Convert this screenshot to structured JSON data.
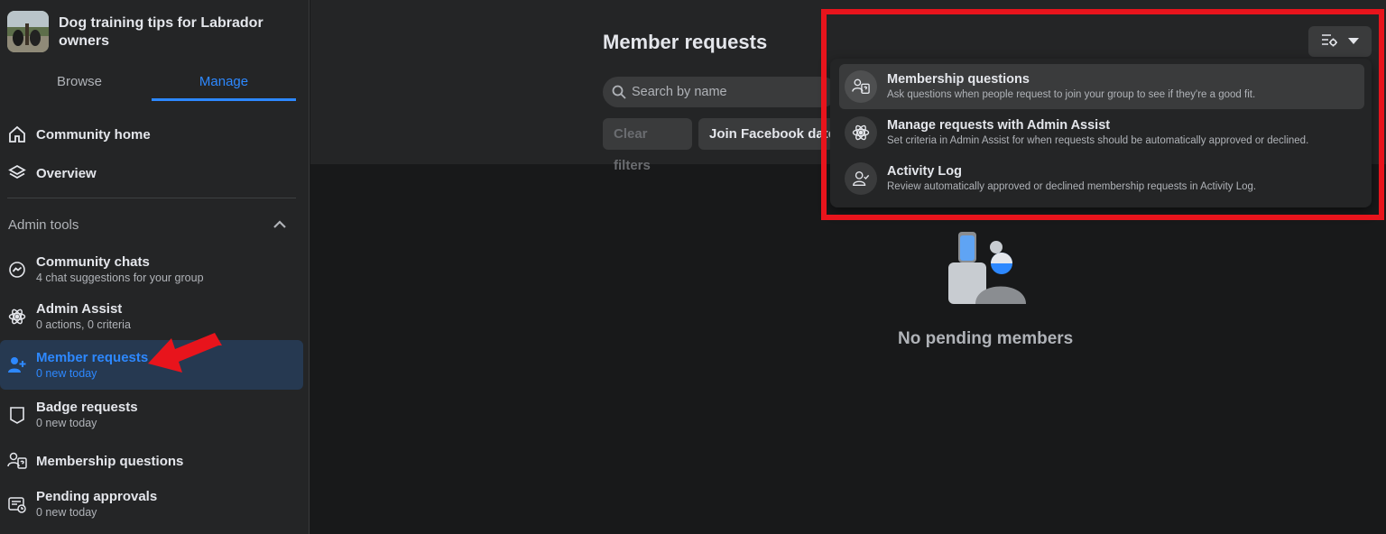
{
  "group": {
    "title": "Dog training tips for Labrador owners"
  },
  "tabs": [
    {
      "label": "Browse"
    },
    {
      "label": "Manage"
    }
  ],
  "nav": {
    "community_home": "Community home",
    "overview": "Overview",
    "admin_tools_title": "Admin tools",
    "community_chats": {
      "label": "Community chats",
      "sub": "4 chat suggestions for your group"
    },
    "admin_assist": {
      "label": "Admin Assist",
      "sub": "0 actions, 0 criteria"
    },
    "member_requests": {
      "label": "Member requests",
      "sub": "0 new today"
    },
    "badge_requests": {
      "label": "Badge requests",
      "sub": "0 new today"
    },
    "membership_questions": {
      "label": "Membership questions"
    },
    "pending_approvals": {
      "label": "Pending approvals",
      "sub": "0 new today"
    }
  },
  "main": {
    "title": "Member requests",
    "search_placeholder": "Search by name",
    "clear_filters": "Clear filters",
    "join_facebook_date": "Join Facebook date",
    "empty_text": "No pending members"
  },
  "dropdown": {
    "items": [
      {
        "title": "Membership questions",
        "desc": "Ask questions when people request to join your group to see if they're a good fit."
      },
      {
        "title": "Manage requests with Admin Assist",
        "desc": "Set criteria in Admin Assist for when requests should be automatically approved or declined."
      },
      {
        "title": "Activity Log",
        "desc": "Review automatically approved or declined membership requests in Activity Log."
      }
    ]
  },
  "colors": {
    "accent": "#2d88ff",
    "highlight_red": "#e8141c",
    "background": "#18191a",
    "surface": "#242526"
  }
}
